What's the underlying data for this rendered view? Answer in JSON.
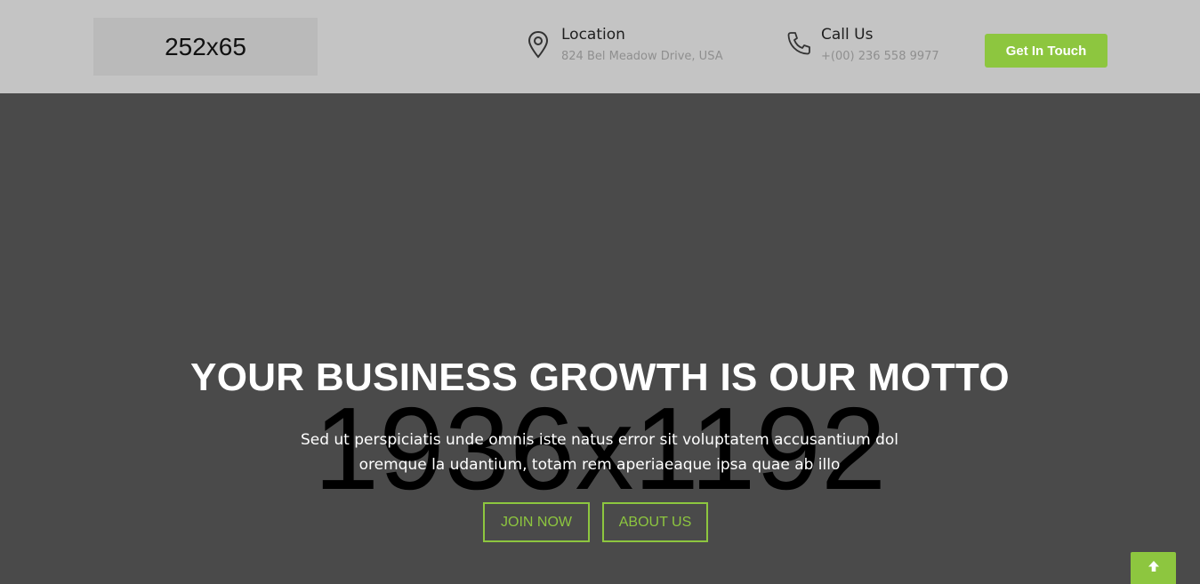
{
  "header": {
    "logo_text": "252x65",
    "location": {
      "title": "Location",
      "detail": "824 Bel Meadow Drive, USA",
      "icon": "map-pin-icon"
    },
    "call": {
      "title": "Call Us",
      "detail": "+(00) 236 558 9977",
      "icon": "phone-icon"
    },
    "cta_label": "Get In Touch"
  },
  "hero": {
    "image_placeholder": "1936x1192",
    "headline": "YOUR BUSINESS GROWTH IS OUR MOTTO",
    "subtext_line1": "Sed ut perspiciatis unde omnis iste natus error sit voluptatem accusantium dol",
    "subtext_line2": "oremque la udantium, totam rem aperiaeaque ipsa quae ab illo",
    "join_label": "JOIN NOW",
    "about_label": "ABOUT US"
  },
  "scroll_top": {
    "icon": "arrow-up-icon"
  },
  "colors": {
    "accent": "#8dc63f",
    "topbar_bg": "#c4c4c4",
    "hero_bg": "#4a4a4a"
  }
}
